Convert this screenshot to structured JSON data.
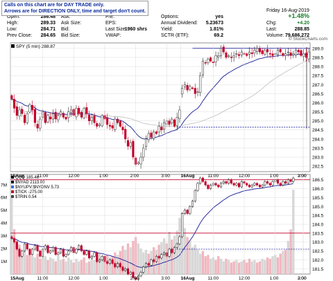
{
  "notice": {
    "line1": "Calls on this chart are for DAY TRADE only.",
    "line2": "Arrows are for DIRECTION ONLY, time and target don't count."
  },
  "quote": {
    "open_label": "Open:",
    "open": "286.48",
    "high_label": "High:",
    "high": "289.33",
    "low_label": "Low:",
    "low": "284.71",
    "prev_close_label": "Prev Close:",
    "prev_close": "284.65",
    "ask_label": "Ask:",
    "ask": "",
    "ask_size_label": "Ask Size:",
    "ask_size": "",
    "bid_label": "Bid:",
    "bid": "",
    "bid_size_label": "Bid Size:",
    "bid_size": "",
    "pe_label": "P/E:",
    "pe": "",
    "eps_label": "EPS:",
    "eps": "",
    "last_size_label": "Last Size:",
    "last_size": "1960 shrs",
    "vwap_label": "VWAP:",
    "vwap": "",
    "options_label": "Options:",
    "options": "yes",
    "annual_div_label": "Annual Dividend:",
    "annual_div": "5.23673",
    "yield_label": "Yield:",
    "yield": "1.81%",
    "sctr_label": "SCTR (ETF):",
    "sctr": "69.2",
    "date": "Friday 16-Aug-2019",
    "pct_change": "+1.48%",
    "chg_label": "Chg:",
    "chg": "+4.20",
    "last_label": "Last:",
    "last": "288.85",
    "volume_label": "Volume:",
    "volume": "79,686,272"
  },
  "watermark": "© StockCharts.com",
  "chart_data": [
    {
      "type": "candlestick",
      "legend": "SPY (5 min) 288.87",
      "xlabel_ticks": [
        "15Aug",
        "11:00",
        "12:00",
        "1:00",
        "2:00",
        "3:00",
        "16Aug",
        "11:00",
        "12:00",
        "1:00",
        "2:00",
        "3:00"
      ],
      "ylim": [
        282.2,
        289.3
      ],
      "yticks": [
        282.5,
        283.0,
        283.5,
        284.0,
        284.5,
        285.0,
        285.5,
        286.0,
        286.5,
        287.0,
        287.5,
        288.0,
        288.5,
        289.0
      ],
      "annotations": {
        "resistance_line": 289.0,
        "support_line": 284.65
      },
      "closes": [
        286.2,
        285.7,
        285.3,
        285.6,
        285.4,
        284.9,
        285.4,
        285.9,
        285.6,
        284.9,
        284.6,
        285.1,
        285.5,
        284.9,
        285.3,
        285.1,
        285.4,
        285.1,
        285.3,
        285.5,
        285.2,
        285.1,
        285.5,
        285.6,
        285.3,
        285.7,
        285.4,
        285.2,
        285.7,
        285.4,
        285.0,
        285.2,
        284.9,
        284.7,
        284.8,
        285.3,
        285.1,
        284.8,
        284.7,
        284.6,
        285.1,
        284.9,
        284.7,
        284.5,
        284.0,
        283.6,
        283.8,
        283.0,
        282.6,
        282.7,
        283.0,
        283.5,
        284.0,
        284.3,
        284.1,
        284.4,
        284.3,
        284.7,
        284.5,
        284.9,
        285.0,
        284.8,
        285.1,
        284.7,
        285.2,
        285.6,
        286.8,
        287.0,
        286.7,
        286.9,
        286.8,
        286.5,
        286.6,
        287.5,
        288.3,
        288.2,
        288.4,
        288.3,
        288.2,
        288.6,
        288.6,
        289.0,
        288.8,
        288.5,
        288.6,
        288.5,
        288.6,
        288.7,
        288.6,
        288.8,
        288.7,
        288.6,
        288.8,
        288.7,
        288.9,
        289.0,
        288.8,
        288.7,
        288.9,
        288.8,
        288.7,
        288.6,
        288.7,
        288.9,
        288.8,
        288.6,
        288.7,
        288.8,
        288.6,
        288.7,
        288.9,
        288.8,
        288.6,
        288.7,
        288.5,
        288.8
      ]
    },
    {
      "type": "line",
      "legend": [
        "QQQ 185.46",
        "$NYAD 2113.00",
        "$NYUPV:$NYDNV 5.73",
        "$TICK -275.00",
        "$TRIN 0.54"
      ],
      "right_yticks": [
        181.5,
        182.0,
        182.5,
        183.0,
        183.5,
        184.0,
        184.5,
        185.0,
        185.5,
        186.0,
        186.5
      ],
      "left_yticks": [
        "1M",
        "2M",
        "3M",
        "4M",
        "5M",
        "6M",
        "7M"
      ],
      "xlabel_ticks": [
        "15Aug",
        "11:00",
        "12:00",
        "1:00",
        "2:00",
        "3:00",
        "16Aug",
        "11:00",
        "12:00",
        "1:00",
        "2:00",
        "3:00"
      ],
      "annotations": {
        "resistance_line": 186.5,
        "middle_line": 183.5,
        "support_line": 182.6
      },
      "closes": [
        183.2,
        183.0,
        182.6,
        182.2,
        182.5,
        182.9,
        182.6,
        182.3,
        182.6,
        182.8,
        182.5,
        182.2,
        182.6,
        182.8,
        182.4,
        182.5,
        182.7,
        182.3,
        182.4,
        182.6,
        182.2,
        182.3,
        182.5,
        182.7,
        182.4,
        182.6,
        182.8,
        182.5,
        182.3,
        182.5,
        182.1,
        182.2,
        182.4,
        181.9,
        182.0,
        182.2,
        181.9,
        181.8,
        182.0,
        181.8,
        181.6,
        181.8,
        181.6,
        181.4,
        181.5,
        181.2,
        181.3,
        181.0,
        180.9,
        181.1,
        181.3,
        181.6,
        181.8,
        181.7,
        182.0,
        181.9,
        182.2,
        182.1,
        182.3,
        182.4,
        182.2,
        182.6,
        182.4,
        182.7,
        182.9,
        183.3,
        184.6,
        184.8,
        184.6,
        185.0,
        185.3,
        185.9,
        186.3,
        186.6,
        186.4,
        186.2,
        186.0,
        186.2,
        186.3,
        186.2,
        186.1,
        186.3,
        186.4,
        186.3,
        186.5,
        186.3,
        186.2,
        186.3,
        186.1,
        186.4,
        186.3,
        186.2,
        186.1,
        186.2,
        186.3,
        186.2,
        186.1,
        186.2,
        186.4,
        186.3,
        186.2,
        186.4,
        186.5,
        186.3,
        186.2,
        186.4,
        186.3,
        186.5,
        186.4,
        186.6
      ],
      "volumes": [
        6.2,
        3.5,
        2.6,
        2.3,
        1.6,
        1.9,
        1.5,
        1.7,
        1.4,
        1.3,
        1.6,
        1.2,
        1.5,
        1.4,
        1.1,
        1.3,
        1.2,
        1.0,
        1.4,
        1.1,
        1.2,
        1.0,
        1.3,
        1.1,
        0.9,
        1.2,
        1.0,
        1.1,
        1.3,
        0.9,
        1.0,
        1.2,
        1.1,
        1.3,
        1.6,
        1.4,
        1.2,
        1.5,
        1.3,
        1.4,
        1.7,
        1.5,
        1.8,
        2.2,
        1.9,
        2.4,
        2.1,
        2.6,
        2.9,
        2.4,
        2.0,
        1.7,
        1.9,
        1.6,
        1.8,
        2.1,
        1.9,
        2.3,
        2.5,
        2.8,
        2.4,
        3.3,
        2.7,
        3.0,
        3.4,
        4.4,
        4.8,
        3.6,
        2.9,
        2.6,
        2.1,
        2.3,
        1.9,
        1.6,
        1.8,
        1.4,
        1.5,
        1.2,
        1.3,
        1.1,
        1.4,
        1.2,
        1.0,
        1.2,
        1.1,
        0.9,
        1.0,
        1.1,
        0.9,
        1.0,
        1.1,
        0.9,
        1.2,
        1.0,
        1.1,
        0.9,
        1.0,
        1.2,
        1.1,
        1.3,
        1.2,
        1.4,
        1.5,
        1.3,
        1.6,
        1.8,
        1.9,
        2.6,
        3.5,
        6.6
      ]
    }
  ]
}
